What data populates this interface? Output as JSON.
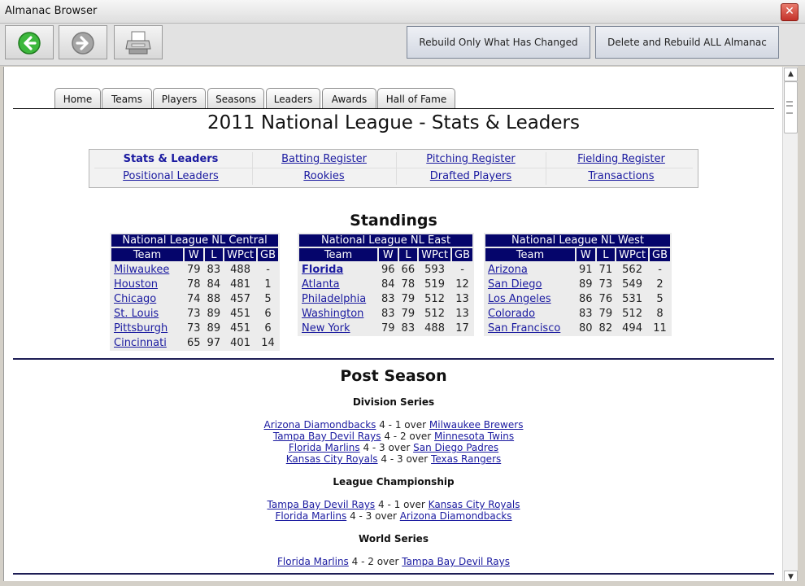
{
  "window": {
    "title": "Almanac Browser",
    "close_glyph": "✕"
  },
  "toolbar": {
    "back_icon": "back-arrow-icon",
    "forward_icon": "forward-arrow-icon",
    "print_icon": "printer-icon",
    "rebuild_changed": "Rebuild Only What Has Changed",
    "rebuild_all": "Delete and Rebuild ALL Almanac Files"
  },
  "tabs": [
    "Home",
    "Teams",
    "Players",
    "Seasons",
    "Leaders",
    "Awards",
    "Hall of Fame"
  ],
  "page_title": "2011 National League - Stats & Leaders",
  "subnav": [
    {
      "label": "Stats & Leaders",
      "active": true
    },
    {
      "label": "Batting Register"
    },
    {
      "label": "Pitching Register"
    },
    {
      "label": "Fielding Register"
    },
    {
      "label": "Positional Leaders"
    },
    {
      "label": "Rookies"
    },
    {
      "label": "Drafted Players"
    },
    {
      "label": "Transactions"
    }
  ],
  "standings": {
    "heading": "Standings",
    "columns": [
      "Team",
      "W",
      "L",
      "WPct",
      "GB"
    ],
    "divisions": [
      {
        "name": "National League NL Central",
        "rows": [
          [
            "Milwaukee",
            "79",
            "83",
            "488",
            "-"
          ],
          [
            "Houston",
            "78",
            "84",
            "481",
            "1"
          ],
          [
            "Chicago",
            "74",
            "88",
            "457",
            "5"
          ],
          [
            "St. Louis",
            "73",
            "89",
            "451",
            "6"
          ],
          [
            "Pittsburgh",
            "73",
            "89",
            "451",
            "6"
          ],
          [
            "Cincinnati",
            "65",
            "97",
            "401",
            "14"
          ]
        ]
      },
      {
        "name": "National League NL East",
        "rows": [
          [
            "Florida",
            "96",
            "66",
            "593",
            "-"
          ],
          [
            "Atlanta",
            "84",
            "78",
            "519",
            "12"
          ],
          [
            "Philadelphia",
            "83",
            "79",
            "512",
            "13"
          ],
          [
            "Washington",
            "83",
            "79",
            "512",
            "13"
          ],
          [
            "New York",
            "79",
            "83",
            "488",
            "17"
          ]
        ]
      },
      {
        "name": "National League NL West",
        "rows": [
          [
            "Arizona",
            "91",
            "71",
            "562",
            "-"
          ],
          [
            "San Diego",
            "89",
            "73",
            "549",
            "2"
          ],
          [
            "Los Angeles",
            "86",
            "76",
            "531",
            "5"
          ],
          [
            "Colorado",
            "83",
            "79",
            "512",
            "8"
          ],
          [
            "San Francisco",
            "80",
            "82",
            "494",
            "11"
          ]
        ]
      }
    ]
  },
  "post_season": {
    "heading": "Post Season",
    "rounds": [
      {
        "name": "Division Series",
        "results": [
          {
            "winner": "Arizona  Diamondbacks",
            "score": "4 - 1",
            "loser": "Milwaukee  Brewers"
          },
          {
            "winner": "Tampa Bay  Devil Rays",
            "score": "4 - 2",
            "loser": "Minnesota  Twins"
          },
          {
            "winner": "Florida  Marlins",
            "score": "4 - 3",
            "loser": "San Diego  Padres"
          },
          {
            "winner": "Kansas City  Royals",
            "score": "4 - 3",
            "loser": "Texas  Rangers"
          }
        ]
      },
      {
        "name": "League Championship",
        "results": [
          {
            "winner": "Tampa Bay  Devil Rays",
            "score": "4 - 1",
            "loser": "Kansas City  Royals"
          },
          {
            "winner": "Florida  Marlins",
            "score": "4 - 3",
            "loser": "Arizona  Diamondbacks"
          }
        ]
      },
      {
        "name": "World Series",
        "results": [
          {
            "winner": "Florida  Marlins",
            "score": "4 - 2",
            "loser": "Tampa Bay  Devil Rays"
          }
        ]
      }
    ],
    "over_word": "over"
  }
}
